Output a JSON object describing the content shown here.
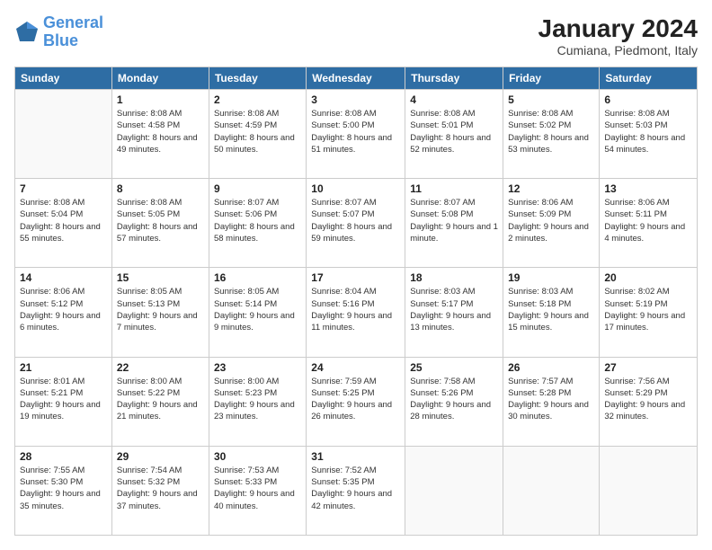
{
  "logo": {
    "line1": "General",
    "line2": "Blue"
  },
  "title": "January 2024",
  "subtitle": "Cumiana, Piedmont, Italy",
  "weekdays": [
    "Sunday",
    "Monday",
    "Tuesday",
    "Wednesday",
    "Thursday",
    "Friday",
    "Saturday"
  ],
  "weeks": [
    [
      {
        "day": "",
        "sunrise": "",
        "sunset": "",
        "daylight": ""
      },
      {
        "day": "1",
        "sunrise": "Sunrise: 8:08 AM",
        "sunset": "Sunset: 4:58 PM",
        "daylight": "Daylight: 8 hours and 49 minutes."
      },
      {
        "day": "2",
        "sunrise": "Sunrise: 8:08 AM",
        "sunset": "Sunset: 4:59 PM",
        "daylight": "Daylight: 8 hours and 50 minutes."
      },
      {
        "day": "3",
        "sunrise": "Sunrise: 8:08 AM",
        "sunset": "Sunset: 5:00 PM",
        "daylight": "Daylight: 8 hours and 51 minutes."
      },
      {
        "day": "4",
        "sunrise": "Sunrise: 8:08 AM",
        "sunset": "Sunset: 5:01 PM",
        "daylight": "Daylight: 8 hours and 52 minutes."
      },
      {
        "day": "5",
        "sunrise": "Sunrise: 8:08 AM",
        "sunset": "Sunset: 5:02 PM",
        "daylight": "Daylight: 8 hours and 53 minutes."
      },
      {
        "day": "6",
        "sunrise": "Sunrise: 8:08 AM",
        "sunset": "Sunset: 5:03 PM",
        "daylight": "Daylight: 8 hours and 54 minutes."
      }
    ],
    [
      {
        "day": "7",
        "sunrise": "Sunrise: 8:08 AM",
        "sunset": "Sunset: 5:04 PM",
        "daylight": "Daylight: 8 hours and 55 minutes."
      },
      {
        "day": "8",
        "sunrise": "Sunrise: 8:08 AM",
        "sunset": "Sunset: 5:05 PM",
        "daylight": "Daylight: 8 hours and 57 minutes."
      },
      {
        "day": "9",
        "sunrise": "Sunrise: 8:07 AM",
        "sunset": "Sunset: 5:06 PM",
        "daylight": "Daylight: 8 hours and 58 minutes."
      },
      {
        "day": "10",
        "sunrise": "Sunrise: 8:07 AM",
        "sunset": "Sunset: 5:07 PM",
        "daylight": "Daylight: 8 hours and 59 minutes."
      },
      {
        "day": "11",
        "sunrise": "Sunrise: 8:07 AM",
        "sunset": "Sunset: 5:08 PM",
        "daylight": "Daylight: 9 hours and 1 minute."
      },
      {
        "day": "12",
        "sunrise": "Sunrise: 8:06 AM",
        "sunset": "Sunset: 5:09 PM",
        "daylight": "Daylight: 9 hours and 2 minutes."
      },
      {
        "day": "13",
        "sunrise": "Sunrise: 8:06 AM",
        "sunset": "Sunset: 5:11 PM",
        "daylight": "Daylight: 9 hours and 4 minutes."
      }
    ],
    [
      {
        "day": "14",
        "sunrise": "Sunrise: 8:06 AM",
        "sunset": "Sunset: 5:12 PM",
        "daylight": "Daylight: 9 hours and 6 minutes."
      },
      {
        "day": "15",
        "sunrise": "Sunrise: 8:05 AM",
        "sunset": "Sunset: 5:13 PM",
        "daylight": "Daylight: 9 hours and 7 minutes."
      },
      {
        "day": "16",
        "sunrise": "Sunrise: 8:05 AM",
        "sunset": "Sunset: 5:14 PM",
        "daylight": "Daylight: 9 hours and 9 minutes."
      },
      {
        "day": "17",
        "sunrise": "Sunrise: 8:04 AM",
        "sunset": "Sunset: 5:16 PM",
        "daylight": "Daylight: 9 hours and 11 minutes."
      },
      {
        "day": "18",
        "sunrise": "Sunrise: 8:03 AM",
        "sunset": "Sunset: 5:17 PM",
        "daylight": "Daylight: 9 hours and 13 minutes."
      },
      {
        "day": "19",
        "sunrise": "Sunrise: 8:03 AM",
        "sunset": "Sunset: 5:18 PM",
        "daylight": "Daylight: 9 hours and 15 minutes."
      },
      {
        "day": "20",
        "sunrise": "Sunrise: 8:02 AM",
        "sunset": "Sunset: 5:19 PM",
        "daylight": "Daylight: 9 hours and 17 minutes."
      }
    ],
    [
      {
        "day": "21",
        "sunrise": "Sunrise: 8:01 AM",
        "sunset": "Sunset: 5:21 PM",
        "daylight": "Daylight: 9 hours and 19 minutes."
      },
      {
        "day": "22",
        "sunrise": "Sunrise: 8:00 AM",
        "sunset": "Sunset: 5:22 PM",
        "daylight": "Daylight: 9 hours and 21 minutes."
      },
      {
        "day": "23",
        "sunrise": "Sunrise: 8:00 AM",
        "sunset": "Sunset: 5:23 PM",
        "daylight": "Daylight: 9 hours and 23 minutes."
      },
      {
        "day": "24",
        "sunrise": "Sunrise: 7:59 AM",
        "sunset": "Sunset: 5:25 PM",
        "daylight": "Daylight: 9 hours and 26 minutes."
      },
      {
        "day": "25",
        "sunrise": "Sunrise: 7:58 AM",
        "sunset": "Sunset: 5:26 PM",
        "daylight": "Daylight: 9 hours and 28 minutes."
      },
      {
        "day": "26",
        "sunrise": "Sunrise: 7:57 AM",
        "sunset": "Sunset: 5:28 PM",
        "daylight": "Daylight: 9 hours and 30 minutes."
      },
      {
        "day": "27",
        "sunrise": "Sunrise: 7:56 AM",
        "sunset": "Sunset: 5:29 PM",
        "daylight": "Daylight: 9 hours and 32 minutes."
      }
    ],
    [
      {
        "day": "28",
        "sunrise": "Sunrise: 7:55 AM",
        "sunset": "Sunset: 5:30 PM",
        "daylight": "Daylight: 9 hours and 35 minutes."
      },
      {
        "day": "29",
        "sunrise": "Sunrise: 7:54 AM",
        "sunset": "Sunset: 5:32 PM",
        "daylight": "Daylight: 9 hours and 37 minutes."
      },
      {
        "day": "30",
        "sunrise": "Sunrise: 7:53 AM",
        "sunset": "Sunset: 5:33 PM",
        "daylight": "Daylight: 9 hours and 40 minutes."
      },
      {
        "day": "31",
        "sunrise": "Sunrise: 7:52 AM",
        "sunset": "Sunset: 5:35 PM",
        "daylight": "Daylight: 9 hours and 42 minutes."
      },
      {
        "day": "",
        "sunrise": "",
        "sunset": "",
        "daylight": ""
      },
      {
        "day": "",
        "sunrise": "",
        "sunset": "",
        "daylight": ""
      },
      {
        "day": "",
        "sunrise": "",
        "sunset": "",
        "daylight": ""
      }
    ]
  ]
}
